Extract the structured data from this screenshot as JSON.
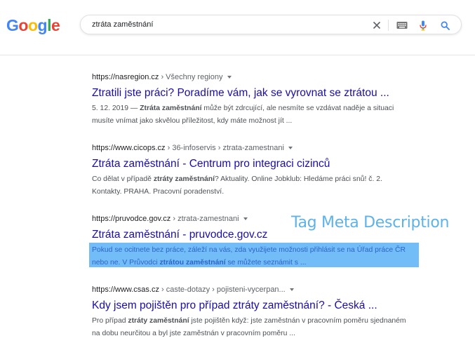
{
  "logo": {
    "letters": [
      "G",
      "o",
      "o",
      "g",
      "l",
      "e"
    ],
    "colors": [
      "#4285F4",
      "#EA4335",
      "#FBBC05",
      "#4285F4",
      "#34A853",
      "#EA4335"
    ]
  },
  "search": {
    "query": "ztráta zaměstnání",
    "icons": [
      "close-icon",
      "keyboard-icon",
      "microphone-icon",
      "search-icon"
    ]
  },
  "results": [
    {
      "domain": "https://nasregion.cz",
      "path": " › Všechny regiony",
      "title": "Ztratili jste práci? Poradíme vám, jak se vyrovnat se ztrátou ...",
      "snippet_parts": [
        {
          "text": "5. 12. 2019 — ",
          "bold": false
        },
        {
          "text": "Ztráta zaměstnání",
          "bold": true
        },
        {
          "text": " může být zdrcující, ale nesmíte se vzdávat naděje a situaci musíte vnímat jako skvělou příležitost, kdy máte možnost jít ...",
          "bold": false
        }
      ]
    },
    {
      "domain": "https://www.cicops.cz",
      "path": " › 36-infoservis › ztrata-zamestnani",
      "title": "Ztráta zaměstnání - Centrum pro integraci cizinců",
      "snippet_parts": [
        {
          "text": "Co dělat v případě ",
          "bold": false
        },
        {
          "text": "ztráty zaměstnání",
          "bold": true
        },
        {
          "text": "? Aktuality. Online Jobklub: Hledáme práci snů! č. 2. Kontakty. PRAHA. Pracovní poradenství.",
          "bold": false
        }
      ]
    },
    {
      "domain": "https://pruvodce.gov.cz",
      "path": " › ztrata-zamestnani",
      "title": "Ztráta zaměstnání - pruvodce.gov.cz",
      "snippet_parts": [
        {
          "text": "Pokud se ocitnete bez práce, záleží na vás, zda využijete možnosti přihlásit se na Úřad práce ČR nebo ne. V Průvodci ",
          "bold": false
        },
        {
          "text": "ztrátou zaměstnání",
          "bold": true
        },
        {
          "text": " se můžete seznámit s ...",
          "bold": false
        }
      ]
    },
    {
      "domain": "https://www.csas.cz",
      "path": " › caste-dotazy › pojisteni-vycerpan...",
      "title": "Kdy jsem pojištěn pro případ ztráty zaměstnání? - Česká ...",
      "snippet_parts": [
        {
          "text": "Pro případ ",
          "bold": false
        },
        {
          "text": "ztráty zaměstnání",
          "bold": true
        },
        {
          "text": " jste pojištěn když: jste zaměstnán v pracovním poměru sjednaném na dobu neurčitou a byl jste zaměstnán v pracovním poměru ...",
          "bold": false
        }
      ]
    }
  ],
  "annotation": {
    "label": "Tag Meta Description",
    "highlight_color": "#72bdf7"
  }
}
